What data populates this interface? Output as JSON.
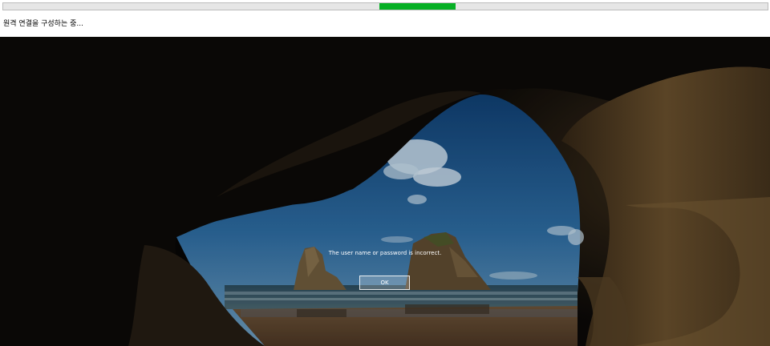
{
  "connection": {
    "status_text": "원격 연결을 구성하는 중...",
    "progress": {
      "segment_start_fraction": 0.492,
      "segment_width_fraction": 0.1,
      "color": "#06b025"
    }
  },
  "lock_screen": {
    "error_message": "The user name or password is incorrect.",
    "ok_label": "OK"
  }
}
